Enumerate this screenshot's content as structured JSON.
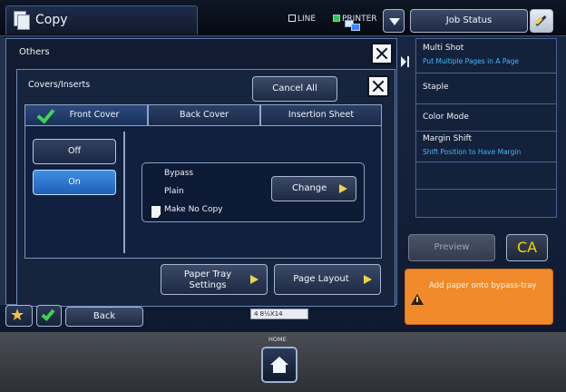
{
  "topbar": {
    "mode_title": "Copy",
    "line_label": "LINE",
    "printer_label": "PRINTER",
    "job_status_label": "Job Status"
  },
  "others_panel": {
    "title": "Others"
  },
  "covers_dialog": {
    "title": "Covers/Inserts",
    "cancel_all_label": "Cancel All",
    "tabs": [
      {
        "label": "Front Cover",
        "active": true
      },
      {
        "label": "Back Cover",
        "active": false
      },
      {
        "label": "Insertion Sheet",
        "active": false
      }
    ],
    "off_label": "Off",
    "on_label": "On",
    "selected": "On",
    "tray_lines": [
      "Bypass",
      "Plain",
      "Make No Copy"
    ],
    "change_label": "Change",
    "paper_tray_settings_label": "Paper Tray\nSettings",
    "page_layout_label": "Page Layout"
  },
  "right_list": {
    "items": [
      {
        "label": "Multi Shot",
        "sub": "Put Multiple Pages in A Page"
      },
      {
        "label": "Staple",
        "sub": ""
      },
      {
        "label": "Color Mode",
        "sub": ""
      },
      {
        "label": "Margin Shift",
        "sub": "Shift Position to Have Margin"
      },
      {
        "label": "",
        "sub": ""
      },
      {
        "label": "",
        "sub": ""
      }
    ]
  },
  "preview_label": "Preview",
  "ca_label": "CA",
  "message": "Add paper onto bypass-tray",
  "back_label": "Back",
  "tray_indicator": "4  8½X14",
  "home_label": "HOME",
  "colors": {
    "accent_blue": "#3f8fe6",
    "warning_orange": "#f08a2a",
    "ca_yellow": "#f6d400"
  }
}
